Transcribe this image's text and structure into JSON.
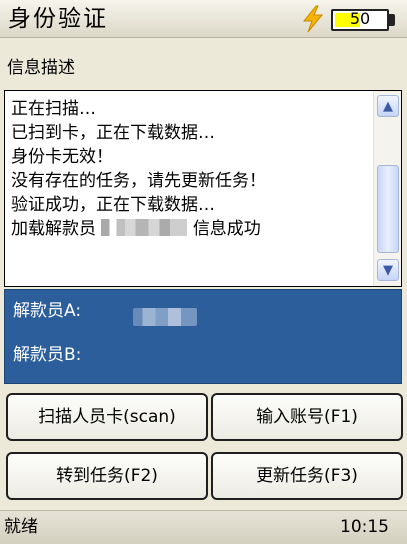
{
  "titlebar": {
    "title": "身份验证",
    "charging_icon": "lightning-bolt-icon",
    "battery_level_text": "50",
    "battery_fill_fraction": 0.5,
    "battery_fill_color": "#ffff00"
  },
  "info": {
    "label": "信息描述",
    "log_lines": [
      "正在扫描…",
      "已扫到卡，正在下载数据…",
      "身份卡无效！",
      "没有存在的任务，请先更新任务！",
      "验证成功，正在下载数据…"
    ],
    "last_line_prefix": "加载解款员",
    "last_line_suffix": "信息成功"
  },
  "panel": {
    "color": "#2b5e9a",
    "cashier_a_label": "解款员A:",
    "cashier_b_label": "解款员B:"
  },
  "buttons": {
    "scan": "扫描人员卡(scan)",
    "account": "输入账号(F1)",
    "tasks": "转到任务(F2)",
    "update": "更新任务(F3)"
  },
  "statusbar": {
    "status": "就绪",
    "time": "10:15"
  }
}
